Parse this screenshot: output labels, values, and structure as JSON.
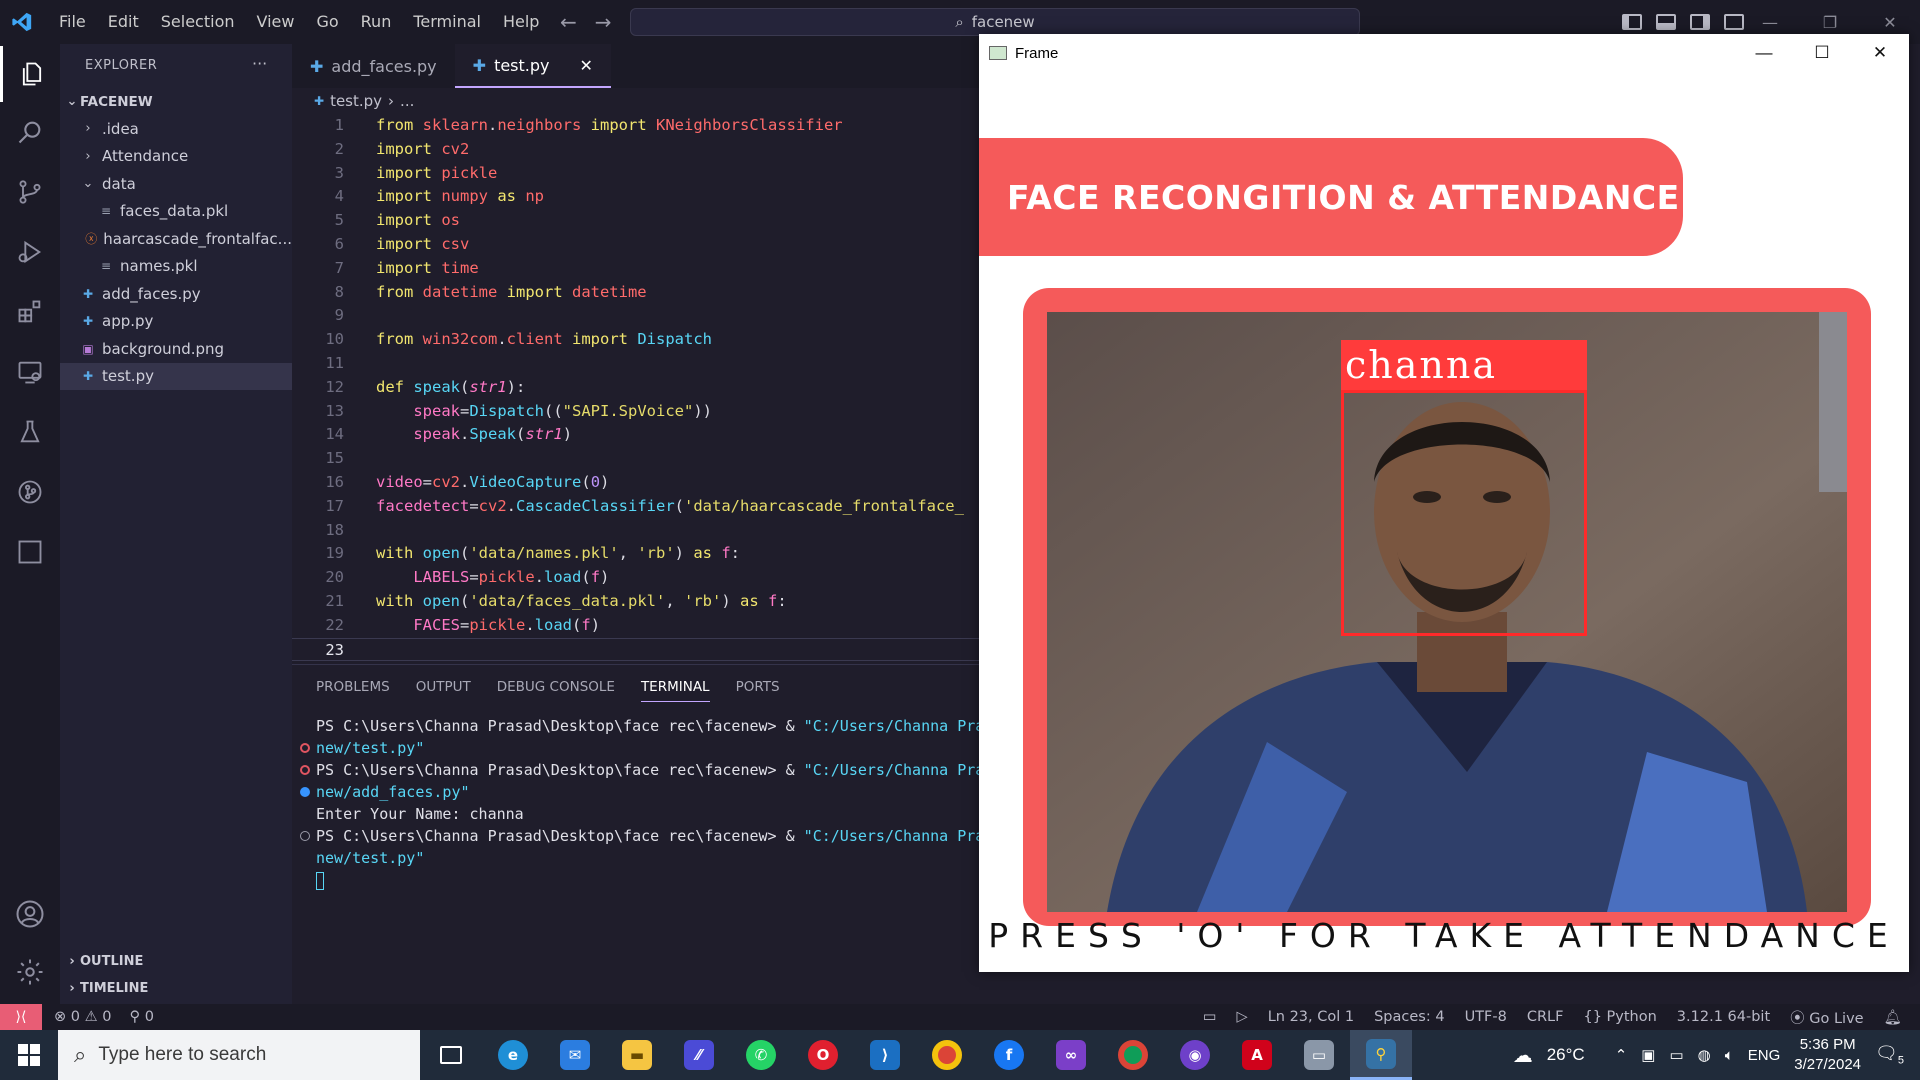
{
  "titlebar": {
    "menu": [
      "File",
      "Edit",
      "Selection",
      "View",
      "Go",
      "Run",
      "Terminal",
      "Help"
    ],
    "search": "facenew"
  },
  "sidebar": {
    "title": "EXPLORER",
    "more": "···",
    "root": "FACENEW",
    "items": [
      {
        "label": ".idea",
        "type": "folder",
        "indent": 1
      },
      {
        "label": "Attendance",
        "type": "folder",
        "indent": 1
      },
      {
        "label": "data",
        "type": "folder-open",
        "indent": 1
      },
      {
        "label": "faces_data.pkl",
        "type": "pkl",
        "indent": 2
      },
      {
        "label": "haarcascade_frontalfac...",
        "type": "xml",
        "indent": 2
      },
      {
        "label": "names.pkl",
        "type": "pkl",
        "indent": 2
      },
      {
        "label": "add_faces.py",
        "type": "py",
        "indent": 1
      },
      {
        "label": "app.py",
        "type": "py",
        "indent": 1
      },
      {
        "label": "background.png",
        "type": "img",
        "indent": 1
      },
      {
        "label": "test.py",
        "type": "py",
        "indent": 1,
        "selected": true
      }
    ],
    "outline": "OUTLINE",
    "timeline": "TIMELINE"
  },
  "editor": {
    "tabs": [
      {
        "label": "add_faces.py",
        "active": false
      },
      {
        "label": "test.py",
        "active": true
      }
    ],
    "breadcrumb_file": "test.py",
    "breadcrumb_rest": "...",
    "lines": [
      {
        "n": "1",
        "parts": [
          [
            "kw",
            "from "
          ],
          [
            "mod",
            "sklearn"
          ],
          [
            "plain",
            "."
          ],
          [
            "mod",
            "neighbors"
          ],
          [
            "kw",
            " import "
          ],
          [
            "mod",
            "KNeighborsClassifier"
          ]
        ]
      },
      {
        "n": "2",
        "parts": [
          [
            "kw",
            "import "
          ],
          [
            "mod",
            "cv2"
          ]
        ]
      },
      {
        "n": "3",
        "parts": [
          [
            "kw",
            "import "
          ],
          [
            "mod",
            "pickle"
          ]
        ]
      },
      {
        "n": "4",
        "parts": [
          [
            "kw",
            "import "
          ],
          [
            "mod",
            "numpy"
          ],
          [
            "kw",
            " as "
          ],
          [
            "mod",
            "np"
          ]
        ]
      },
      {
        "n": "5",
        "parts": [
          [
            "kw",
            "import "
          ],
          [
            "mod",
            "os"
          ]
        ]
      },
      {
        "n": "6",
        "parts": [
          [
            "kw",
            "import "
          ],
          [
            "mod",
            "csv"
          ]
        ]
      },
      {
        "n": "7",
        "parts": [
          [
            "kw",
            "import "
          ],
          [
            "mod",
            "time"
          ]
        ]
      },
      {
        "n": "8",
        "parts": [
          [
            "kw",
            "from "
          ],
          [
            "mod",
            "datetime"
          ],
          [
            "kw",
            " import "
          ],
          [
            "mod",
            "datetime"
          ]
        ]
      },
      {
        "n": "9",
        "parts": []
      },
      {
        "n": "10",
        "parts": [
          [
            "kw",
            "from "
          ],
          [
            "mod",
            "win32com"
          ],
          [
            "plain",
            "."
          ],
          [
            "mod",
            "client"
          ],
          [
            "kw",
            " import "
          ],
          [
            "cls",
            "Dispatch"
          ]
        ]
      },
      {
        "n": "11",
        "parts": []
      },
      {
        "n": "12",
        "parts": [
          [
            "kw",
            "def "
          ],
          [
            "fn",
            "speak"
          ],
          [
            "plain",
            "("
          ],
          [
            "prm",
            "str1"
          ],
          [
            "plain",
            "):"
          ]
        ]
      },
      {
        "n": "13",
        "parts": [
          [
            "plain",
            "    "
          ],
          [
            "var",
            "speak"
          ],
          [
            "plain",
            "="
          ],
          [
            "cls",
            "Dispatch"
          ],
          [
            "plain",
            "(("
          ],
          [
            "str",
            "\"SAPI.SpVoice\""
          ],
          [
            "plain",
            "))"
          ]
        ]
      },
      {
        "n": "14",
        "parts": [
          [
            "plain",
            "    "
          ],
          [
            "var",
            "speak"
          ],
          [
            "plain",
            "."
          ],
          [
            "fn",
            "Speak"
          ],
          [
            "plain",
            "("
          ],
          [
            "prm",
            "str1"
          ],
          [
            "plain",
            ")"
          ]
        ]
      },
      {
        "n": "15",
        "parts": []
      },
      {
        "n": "16",
        "parts": [
          [
            "var",
            "video"
          ],
          [
            "plain",
            "="
          ],
          [
            "mod",
            "cv2"
          ],
          [
            "plain",
            "."
          ],
          [
            "cls",
            "VideoCapture"
          ],
          [
            "plain",
            "("
          ],
          [
            "num",
            "0"
          ],
          [
            "plain",
            ")"
          ]
        ]
      },
      {
        "n": "17",
        "parts": [
          [
            "var",
            "facedetect"
          ],
          [
            "plain",
            "="
          ],
          [
            "mod",
            "cv2"
          ],
          [
            "plain",
            "."
          ],
          [
            "cls",
            "CascadeClassifier"
          ],
          [
            "plain",
            "("
          ],
          [
            "str",
            "'data/haarcascade_frontalface_"
          ]
        ]
      },
      {
        "n": "18",
        "parts": []
      },
      {
        "n": "19",
        "parts": [
          [
            "kw",
            "with "
          ],
          [
            "fn",
            "open"
          ],
          [
            "plain",
            "("
          ],
          [
            "str",
            "'data/names.pkl'"
          ],
          [
            "plain",
            ", "
          ],
          [
            "str",
            "'rb'"
          ],
          [
            "plain",
            ")"
          ],
          [
            "kw",
            " as "
          ],
          [
            "var",
            "f"
          ],
          [
            "plain",
            ":"
          ]
        ]
      },
      {
        "n": "20",
        "parts": [
          [
            "plain",
            "    "
          ],
          [
            "var",
            "LABELS"
          ],
          [
            "plain",
            "="
          ],
          [
            "mod",
            "pickle"
          ],
          [
            "plain",
            "."
          ],
          [
            "fn",
            "load"
          ],
          [
            "plain",
            "("
          ],
          [
            "var",
            "f"
          ],
          [
            "plain",
            ")"
          ]
        ]
      },
      {
        "n": "21",
        "parts": [
          [
            "kw",
            "with "
          ],
          [
            "fn",
            "open"
          ],
          [
            "plain",
            "("
          ],
          [
            "str",
            "'data/faces_data.pkl'"
          ],
          [
            "plain",
            ", "
          ],
          [
            "str",
            "'rb'"
          ],
          [
            "plain",
            ")"
          ],
          [
            "kw",
            " as "
          ],
          [
            "var",
            "f"
          ],
          [
            "plain",
            ":"
          ]
        ]
      },
      {
        "n": "22",
        "parts": [
          [
            "plain",
            "    "
          ],
          [
            "var",
            "FACES"
          ],
          [
            "plain",
            "="
          ],
          [
            "mod",
            "pickle"
          ],
          [
            "plain",
            "."
          ],
          [
            "fn",
            "load"
          ],
          [
            "plain",
            "("
          ],
          [
            "var",
            "f"
          ],
          [
            "plain",
            ")"
          ]
        ]
      },
      {
        "n": "23",
        "parts": [],
        "current": true
      }
    ]
  },
  "panel": {
    "tabs": [
      "PROBLEMS",
      "OUTPUT",
      "DEBUG CONSOLE",
      "TERMINAL",
      "PORTS"
    ],
    "active_tab": "TERMINAL",
    "terminal": [
      {
        "dot": "",
        "prompt": "PS C:\\Users\\Channa Prasad\\Desktop\\face rec\\facenew> & ",
        "arg": "\"C:/Users/Channa Pra"
      },
      {
        "dot": "err",
        "prompt": "",
        "arg": "new/test.py\""
      },
      {
        "dot": "err",
        "prompt": "PS C:\\Users\\Channa Prasad\\Desktop\\face rec\\facenew> & ",
        "arg": "\"C:/Users/Channa Pra"
      },
      {
        "dot": "ok",
        "prompt": "",
        "arg": "new/add_faces.py\""
      },
      {
        "dot": "",
        "prompt": "Enter Your Name: channa",
        "arg": ""
      },
      {
        "dot": "idle",
        "prompt": "PS C:\\Users\\Channa Prasad\\Desktop\\face rec\\facenew> & ",
        "arg": "\"C:/Users/Channa Pra"
      },
      {
        "dot": "",
        "prompt": "",
        "arg": "new/test.py\""
      }
    ]
  },
  "statusbar": {
    "errors": "0",
    "warnings": "0",
    "ports": "0",
    "position": "Ln 23, Col 1",
    "spaces": "Spaces: 4",
    "encoding": "UTF-8",
    "eol": "CRLF",
    "language": "Python",
    "interpreter": "3.12.1 64-bit",
    "golive": "Go Live"
  },
  "frame": {
    "title": "Frame",
    "banner": "FACE RECONGITION & ATTENDANCE",
    "name_label": "channa",
    "footer": "PRESS 'O' FOR TAKE ATTENDANCE"
  },
  "taskbar": {
    "search_placeholder": "Type here to search",
    "temperature": "26°C",
    "language": "ENG",
    "time": "5:36 PM",
    "date": "3/27/2024",
    "notifications": "5"
  },
  "colors": {
    "accent_red": "#f55a5a",
    "face_box": "#ff2a2a",
    "editor_bg": "#1f1d2b"
  }
}
